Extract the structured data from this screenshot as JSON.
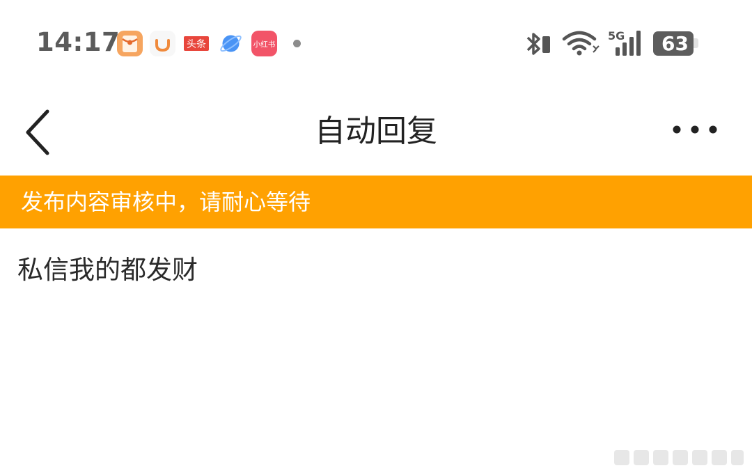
{
  "status_bar": {
    "time": "14:17",
    "battery_level": "63",
    "network_type": "5G",
    "notification_icons": [
      {
        "name": "red-envelope-app-icon",
        "color": "#f4a15d"
      },
      {
        "name": "didi-app-icon",
        "color": "#f08a3c"
      },
      {
        "name": "toutiao-app-icon",
        "label": "头条",
        "color": "#e8463c"
      },
      {
        "name": "browser-app-icon",
        "color": "#3d8cf2"
      },
      {
        "name": "xiaohongshu-app-icon",
        "label": "小红书",
        "color": "#f25468"
      }
    ],
    "system_icons": [
      "bluetooth-icon",
      "wifi-icon",
      "cellular-signal-icon",
      "battery-icon"
    ]
  },
  "header": {
    "title": "自动回复",
    "back_icon": "chevron-left-icon",
    "more_icon": "more-horizontal-icon"
  },
  "banner": {
    "text": "发布内容审核中，请耐心等待",
    "color": "#ffa101"
  },
  "content": {
    "reply_text": "私信我的都发财"
  },
  "colors": {
    "accent": "#ffa101",
    "title_text": "#222222",
    "body_text": "#2a2a2a"
  }
}
